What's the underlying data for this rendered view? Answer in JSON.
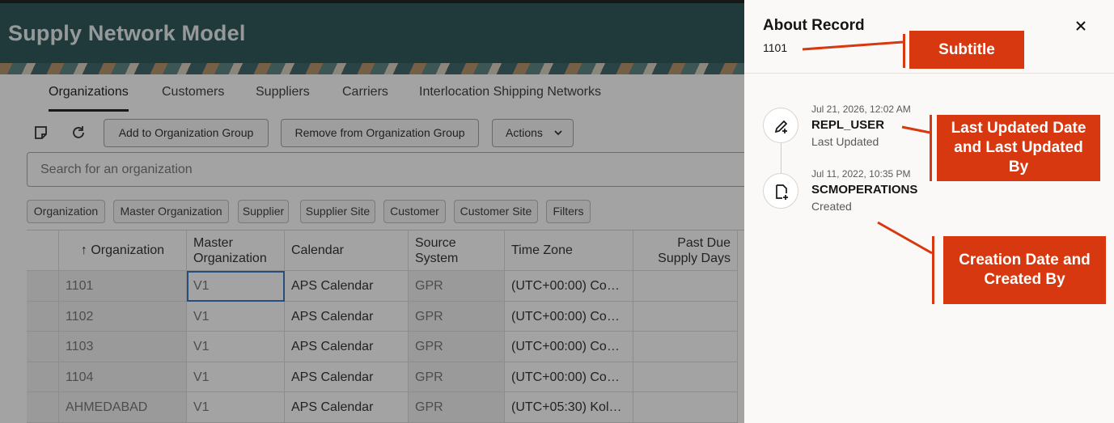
{
  "app": {
    "title": "Supply Network Model",
    "tabs": [
      {
        "label": "Organizations",
        "active": true
      },
      {
        "label": "Customers"
      },
      {
        "label": "Suppliers"
      },
      {
        "label": "Carriers"
      },
      {
        "label": "Interlocation Shipping Networks"
      }
    ],
    "toolbar": {
      "notes_icon": "sticky-note-icon",
      "refresh_icon": "refresh-icon",
      "add_group": "Add to Organization Group",
      "remove_group": "Remove from Organization Group",
      "actions": "Actions"
    },
    "search": {
      "placeholder": "Search for an organization"
    },
    "filters": [
      "Organization",
      "Master Organization",
      "Supplier",
      "Supplier Site",
      "Customer",
      "Customer Site",
      "Filters"
    ],
    "table": {
      "columns": [
        "↑  Organization",
        "Master Organization",
        "Calendar",
        "Source System",
        "Time Zone",
        "Past Due Supply Days"
      ],
      "rows": [
        [
          "1101",
          "V1",
          "APS Calendar",
          "GPR",
          "(UTC+00:00) Coo…",
          ""
        ],
        [
          "1102",
          "V1",
          "APS Calendar",
          "GPR",
          "(UTC+00:00) Coo…",
          ""
        ],
        [
          "1103",
          "V1",
          "APS Calendar",
          "GPR",
          "(UTC+00:00) Coo…",
          ""
        ],
        [
          "1104",
          "V1",
          "APS Calendar",
          "GPR",
          "(UTC+00:00) Coo…",
          ""
        ],
        [
          "AHMEDABAD",
          "V1",
          "APS Calendar",
          "GPR",
          "(UTC+05:30) Kol…",
          ""
        ]
      ]
    }
  },
  "drawer": {
    "title": "About Record",
    "subtitle": "1101",
    "close_icon": "close-icon",
    "events": [
      {
        "date": "Jul 21, 2026, 12:02 AM",
        "user": "REPL_USER",
        "type": "Last Updated",
        "icon": "edit-pencil-icon"
      },
      {
        "date": "Jul 11, 2022, 10:35 PM",
        "user": "SCMOPERATIONS",
        "type": "Created",
        "icon": "new-document-icon"
      }
    ]
  },
  "annotations": {
    "subtitle": "Subtitle",
    "last_updated": "Last Updated Date and Last Updated By",
    "creation": "Creation Date and Created By",
    "color": "#d8380f"
  }
}
